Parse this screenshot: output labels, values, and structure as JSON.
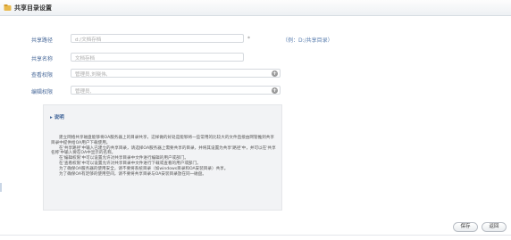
{
  "page": {
    "title": "共享目录设置"
  },
  "form": {
    "share_path": {
      "label": "共享路径",
      "value": "d:/文档存档",
      "required_mark": "*",
      "example": "（例：D:/共享目录）"
    },
    "share_name": {
      "label": "共享名称",
      "value": "文档存档"
    },
    "view_permission": {
      "label": "查看权限",
      "placeholder": "管理员,刘晓伟,"
    },
    "edit_permission": {
      "label": "编辑权限",
      "placeholder": "管理员,"
    }
  },
  "description": {
    "heading": "说明",
    "paragraphs": [
      "建立网络共享磁盘能够将OA服务器上的目录共享，这样做的好处是能够将一些常用的比较大的文件直接由网管推到共享目录中提供给OA用户下载使用。",
      "在'共享路径'中输入已建立的共享目录，请选择OA服务器上需要共享的目录，并将其设置为共享'路径'中，并可以在'共享名称'中输入要在OA中显示的名称。",
      "在'编辑权限'中可以设置允许对共享目录中文件进行编辑的用户或部门。",
      "在'查看权限'中可以设置允许对共享目录中文件进行下载或查看的用户或部门。",
      "为了确保OA服务器的使用安全，请不要将系统目录（如windows目录和OA安装目录）共享。",
      "为了确保OA有足够的使用空间，请不要将共享目录与OA安装目录放在同一磁盘。"
    ]
  },
  "buttons": {
    "save": "保存",
    "back": "返回"
  },
  "colors": {
    "label": "#4a6a9a",
    "hint": "#5b7fb0"
  }
}
